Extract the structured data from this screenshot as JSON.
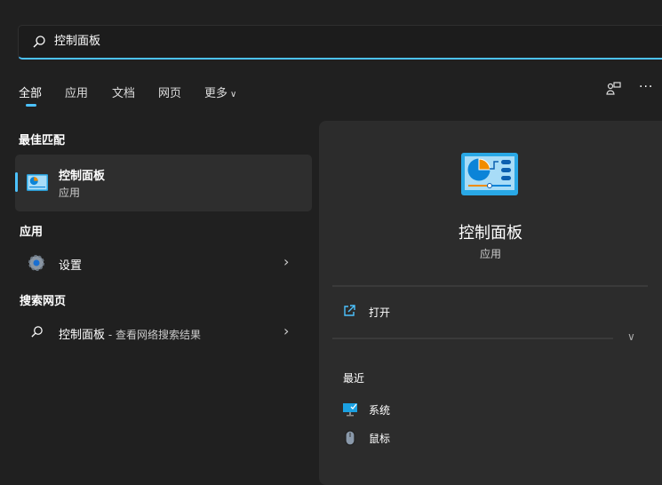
{
  "search": {
    "value": "控制面板"
  },
  "tabs": [
    {
      "label": "全部"
    },
    {
      "label": "应用"
    },
    {
      "label": "文档"
    },
    {
      "label": "网页"
    },
    {
      "label": "更多"
    }
  ],
  "best_match": {
    "header": "最佳匹配",
    "title": "控制面板",
    "subtitle": "应用"
  },
  "apps": {
    "header": "应用",
    "items": [
      {
        "label": "设置"
      }
    ]
  },
  "web": {
    "header": "搜索网页",
    "query": "控制面板",
    "suffix": " - 查看网络搜索结果"
  },
  "detail": {
    "title": "控制面板",
    "subtitle": "应用",
    "open_label": "打开",
    "recent_header": "最近",
    "recent": [
      {
        "label": "系统"
      },
      {
        "label": "鼠标"
      }
    ]
  },
  "colors": {
    "accent": "#4cc2ff",
    "background": "#202020",
    "panel": "#2c2c2c"
  }
}
